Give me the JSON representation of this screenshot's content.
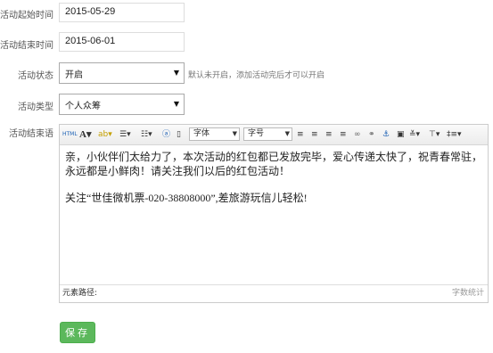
{
  "form": {
    "start_label": "活动起始时间",
    "start_value": "2015-05-29",
    "end_label": "活动结束时间",
    "end_value": "2015-06-01",
    "status_label": "活动状态",
    "status_value": "开启",
    "status_hint": "默认未开启，添加活动完后才可以开启",
    "type_label": "活动类型",
    "type_value": "个人众筹",
    "summary_label": "活动结束语"
  },
  "editor": {
    "font_family_placeholder": "字体",
    "font_size_placeholder": "字号",
    "paragraph1": "亲，小伙伴们太给力了，本次活动的红包都已发放完毕，爱心传递太快了，祝青春常驻，永远都是小鲜肉！请关注我们以后的红包活动！",
    "paragraph2": "关注“世佳微机票-020-38808000”,差旅游玩信儿轻松!",
    "element_path_label": "元素路径:",
    "word_count_label": "字数统计"
  },
  "save_label": "保存"
}
